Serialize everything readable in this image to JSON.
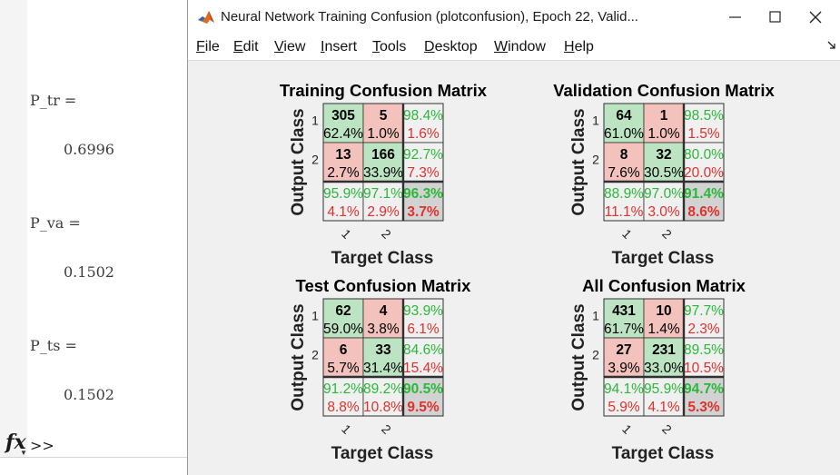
{
  "command_window": {
    "lines": [
      {
        "text": "P_tr =",
        "kind": "var"
      },
      {
        "text": "0.6996",
        "kind": "val"
      },
      {
        "text": "P_va =",
        "kind": "var"
      },
      {
        "text": "0.1502",
        "kind": "val"
      },
      {
        "text": "P_ts =",
        "kind": "var"
      },
      {
        "text": "0.1502",
        "kind": "val"
      }
    ],
    "fx_label": "fx",
    "prompt": ">>"
  },
  "figure_window": {
    "title": "Neural Network Training Confusion (plotconfusion), Epoch 22, Valid...",
    "app_icon": "matlab-icon",
    "controls": {
      "minimize": "minimize-icon",
      "maximize": "maximize-icon",
      "close": "close-icon"
    },
    "menu": [
      {
        "label": "File",
        "key": "F",
        "rest": "ile"
      },
      {
        "label": "Edit",
        "key": "E",
        "rest": "dit"
      },
      {
        "label": "View",
        "key": "V",
        "rest": "iew"
      },
      {
        "label": "Insert",
        "key": "I",
        "rest": "nsert"
      },
      {
        "label": "Tools",
        "key": "T",
        "rest": "ools"
      },
      {
        "label": "Desktop",
        "key": "D",
        "rest": "esktop"
      },
      {
        "label": "Window",
        "key": "W",
        "rest": "indow"
      },
      {
        "label": "Help",
        "key": "H",
        "rest": "elp"
      }
    ],
    "dock_icon": "dock-arrow-icon"
  },
  "colors": {
    "correct_cell": "#bce4c3",
    "wrong_cell": "#f4c2bd",
    "summary_cell": "#f0f0f0",
    "total_cell": "#d2d2d2",
    "green_text": "#2ab83a",
    "red_text": "#e0312d",
    "black_text": "#000000"
  },
  "confusion_matrices": [
    {
      "id": "training",
      "title": "Training Confusion Matrix",
      "xlabel": "Target Class",
      "ylabel": "Output Class",
      "class_labels": [
        "1",
        "2"
      ],
      "counts": [
        [
          "305",
          "5"
        ],
        [
          "13",
          "166"
        ]
      ],
      "percents": [
        [
          "62.4%",
          "1.0%"
        ],
        [
          "2.7%",
          "33.9%"
        ]
      ],
      "row_summary": [
        [
          "98.4%",
          "1.6%"
        ],
        [
          "92.7%",
          "7.3%"
        ]
      ],
      "col_summary": [
        [
          "95.9%",
          "4.1%"
        ],
        [
          "97.1%",
          "2.9%"
        ]
      ],
      "total": [
        "96.3%",
        "3.7%"
      ]
    },
    {
      "id": "validation",
      "title": "Validation Confusion Matrix",
      "xlabel": "Target Class",
      "ylabel": "Output Class",
      "class_labels": [
        "1",
        "2"
      ],
      "counts": [
        [
          "64",
          "1"
        ],
        [
          "8",
          "32"
        ]
      ],
      "percents": [
        [
          "61.0%",
          "1.0%"
        ],
        [
          "7.6%",
          "30.5%"
        ]
      ],
      "row_summary": [
        [
          "98.5%",
          "1.5%"
        ],
        [
          "80.0%",
          "20.0%"
        ]
      ],
      "col_summary": [
        [
          "88.9%",
          "11.1%"
        ],
        [
          "97.0%",
          "3.0%"
        ]
      ],
      "total": [
        "91.4%",
        "8.6%"
      ]
    },
    {
      "id": "test",
      "title": "Test Confusion Matrix",
      "xlabel": "Target Class",
      "ylabel": "Output Class",
      "class_labels": [
        "1",
        "2"
      ],
      "counts": [
        [
          "62",
          "4"
        ],
        [
          "6",
          "33"
        ]
      ],
      "percents": [
        [
          "59.0%",
          "3.8%"
        ],
        [
          "5.7%",
          "31.4%"
        ]
      ],
      "row_summary": [
        [
          "93.9%",
          "6.1%"
        ],
        [
          "84.6%",
          "15.4%"
        ]
      ],
      "col_summary": [
        [
          "91.2%",
          "8.8%"
        ],
        [
          "89.2%",
          "10.8%"
        ]
      ],
      "total": [
        "90.5%",
        "9.5%"
      ]
    },
    {
      "id": "all",
      "title": "All Confusion Matrix",
      "xlabel": "Target Class",
      "ylabel": "Output Class",
      "class_labels": [
        "1",
        "2"
      ],
      "counts": [
        [
          "431",
          "10"
        ],
        [
          "27",
          "231"
        ]
      ],
      "percents": [
        [
          "61.7%",
          "1.4%"
        ],
        [
          "3.9%",
          "33.0%"
        ]
      ],
      "row_summary": [
        [
          "97.7%",
          "2.3%"
        ],
        [
          "89.5%",
          "10.5%"
        ]
      ],
      "col_summary": [
        [
          "94.1%",
          "5.9%"
        ],
        [
          "95.9%",
          "4.1%"
        ]
      ],
      "total": [
        "94.7%",
        "5.3%"
      ]
    }
  ]
}
